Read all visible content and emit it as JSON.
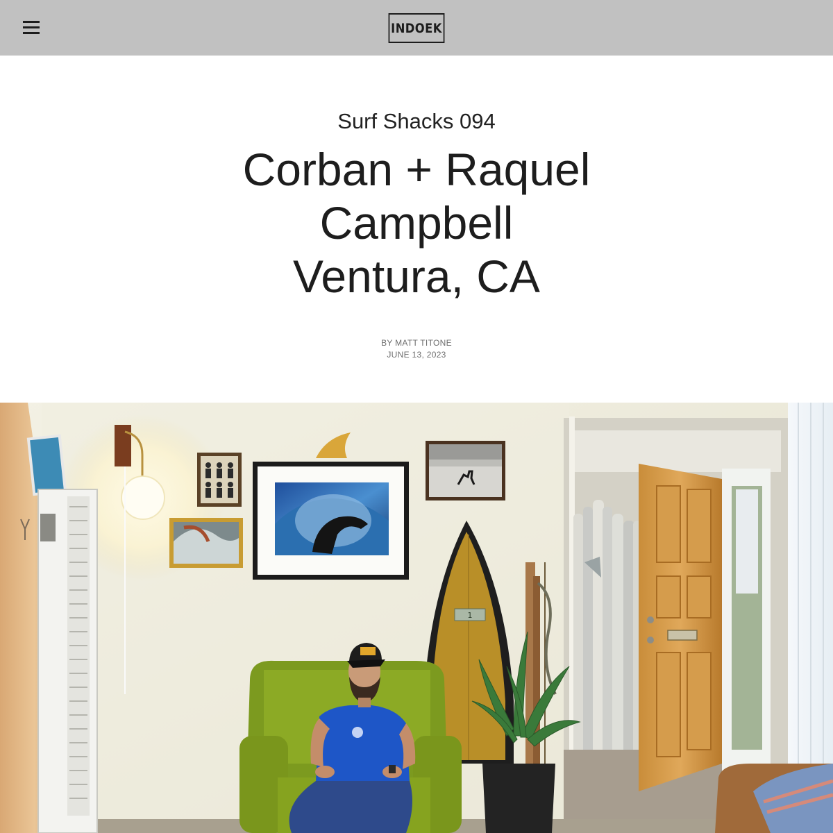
{
  "header": {
    "menu_icon": "hamburger-menu-icon",
    "logo_text": "INDOEK",
    "background_color": "#c1c1c1"
  },
  "article": {
    "kicker": "Surf Shacks 094",
    "headline_lines": [
      "Corban + Raquel",
      "Campbell",
      "Ventura, CA"
    ],
    "author": "BY MATT TITONE",
    "date": "JUNE 13, 2023"
  },
  "hero_image": {
    "subject": "man in blue t-shirt and cap seated in green armchair in a living room with surfboards, framed photos and a wall lamp",
    "dollar_bill_text": "1"
  }
}
